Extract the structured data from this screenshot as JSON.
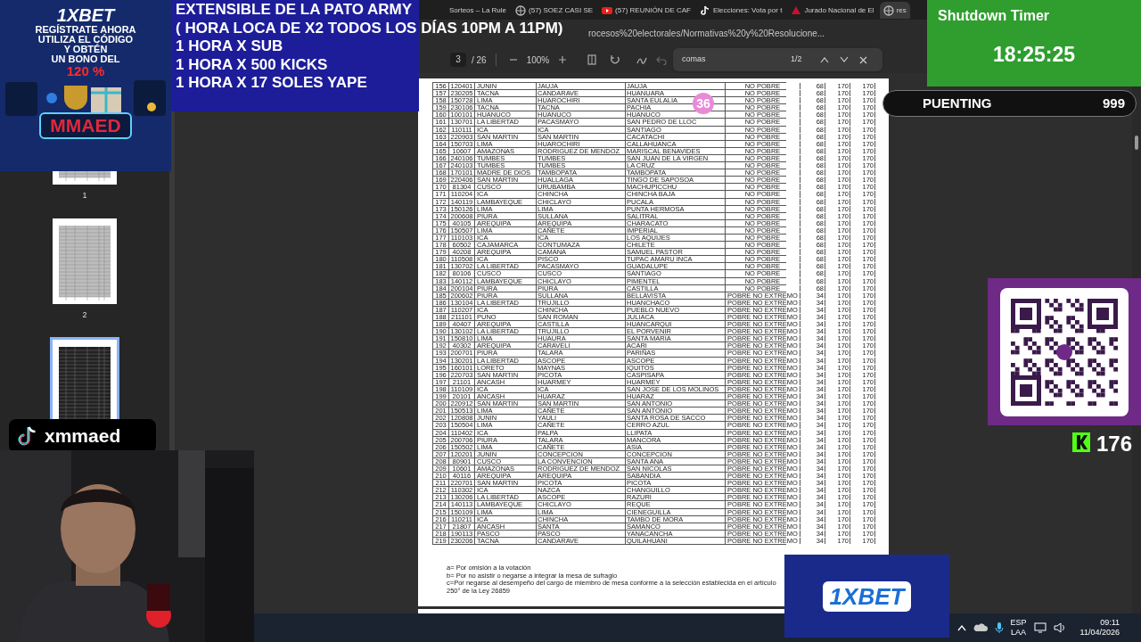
{
  "browser": {
    "tabs": [
      {
        "label": "Sorteos – La Rule",
        "selected": false
      },
      {
        "label": "(57) SOEZ CASI SE",
        "selected": false
      },
      {
        "label": "(57) REUNIÓN DE CAF",
        "selected": false
      },
      {
        "label": "Elecciones: Vota por t",
        "selected": false
      },
      {
        "label": "Jurado Nacional de El",
        "selected": false
      },
      {
        "label": "res",
        "selected": true
      }
    ],
    "address": "rocesos%20electorales/Normativas%20y%20Resolucione..."
  },
  "pdf_toolbar": {
    "page": "3",
    "page_count": "/ 26",
    "zoom": "100%"
  },
  "find_bar": {
    "query": "comas",
    "result": "1/2"
  },
  "sidebar": {
    "thumbnails": [
      {
        "label": "1",
        "selected": false
      },
      {
        "label": "2",
        "selected": false
      },
      {
        "selected": true
      }
    ]
  },
  "document": {
    "table": {
      "rows": [
        [
          "156",
          "120401",
          "JUNIN",
          "JAUJA",
          "JAUJA",
          "NO POBRE",
          "68",
          "170",
          "170"
        ],
        [
          "157",
          "230205",
          "TACNA",
          "CANDARAVE",
          "HUANUARA",
          "NO POBRE",
          "68",
          "170",
          "170"
        ],
        [
          "158",
          "150728",
          "LIMA",
          "HUAROCHIRI",
          "SANTA EULALIA",
          "NO POBRE",
          "68",
          "170",
          "170"
        ],
        [
          "159",
          "230106",
          "TACNA",
          "TACNA",
          "PACHIA",
          "NO POBRE",
          "68",
          "170",
          "170"
        ],
        [
          "160",
          "100101",
          "HUANUCO",
          "HUANUCO",
          "HUANUCO",
          "NO POBRE",
          "68",
          "170",
          "170"
        ],
        [
          "161",
          "130701",
          "LA LIBERTAD",
          "PACASMAYO",
          "SAN PEDRO DE LLOC",
          "NO POBRE",
          "68",
          "170",
          "170"
        ],
        [
          "162",
          "110111",
          "ICA",
          "ICA",
          "SANTIAGO",
          "NO POBRE",
          "68",
          "170",
          "170"
        ],
        [
          "163",
          "220903",
          "SAN MARTIN",
          "SAN MARTIN",
          "CACATACHI",
          "NO POBRE",
          "68",
          "170",
          "170"
        ],
        [
          "164",
          "150703",
          "LIMA",
          "HUAROCHIRI",
          "CALLAHUANCA",
          "NO POBRE",
          "68",
          "170",
          "170"
        ],
        [
          "165",
          "10607",
          "AMAZONAS",
          "RODRIGUEZ DE MENDOZ",
          "MARISCAL BENAVIDES",
          "NO POBRE",
          "68",
          "170",
          "170"
        ],
        [
          "166",
          "240106",
          "TUMBES",
          "TUMBES",
          "SAN JUAN DE LA VIRGEN",
          "NO POBRE",
          "68",
          "170",
          "170"
        ],
        [
          "167",
          "240103",
          "TUMBES",
          "TUMBES",
          "LA CRUZ",
          "NO POBRE",
          "68",
          "170",
          "170"
        ],
        [
          "168",
          "170101",
          "MADRE DE DIOS",
          "TAMBOPATA",
          "TAMBOPATA",
          "NO POBRE",
          "68",
          "170",
          "170"
        ],
        [
          "169",
          "220406",
          "SAN MARTIN",
          "HUALLAGA",
          "TINGO DE SAPOSOA",
          "NO POBRE",
          "68",
          "170",
          "170"
        ],
        [
          "170",
          "81304",
          "CUSCO",
          "URUBAMBA",
          "MACHUPICCHU",
          "NO POBRE",
          "68",
          "170",
          "170"
        ],
        [
          "171",
          "110204",
          "ICA",
          "CHINCHA",
          "CHINCHA BAJA",
          "NO POBRE",
          "68",
          "170",
          "170"
        ],
        [
          "172",
          "140119",
          "LAMBAYEQUE",
          "CHICLAYO",
          "PUCALA",
          "NO POBRE",
          "68",
          "170",
          "170"
        ],
        [
          "173",
          "150126",
          "LIMA",
          "LIMA",
          "PUNTA HERMOSA",
          "NO POBRE",
          "68",
          "170",
          "170"
        ],
        [
          "174",
          "200608",
          "PIURA",
          "SULLANA",
          "SALITRAL",
          "NO POBRE",
          "68",
          "170",
          "170"
        ],
        [
          "175",
          "40105",
          "AREQUIPA",
          "AREQUIPA",
          "CHARACATO",
          "NO POBRE",
          "68",
          "170",
          "170"
        ],
        [
          "176",
          "150507",
          "LIMA",
          "CAÑETE",
          "IMPERIAL",
          "NO POBRE",
          "68",
          "170",
          "170"
        ],
        [
          "177",
          "110103",
          "ICA",
          "ICA",
          "LOS AQUIJES",
          "NO POBRE",
          "68",
          "170",
          "170"
        ],
        [
          "178",
          "60502",
          "CAJAMARCA",
          "CONTUMAZA",
          "CHILETE",
          "NO POBRE",
          "68",
          "170",
          "170"
        ],
        [
          "179",
          "40208",
          "AREQUIPA",
          "CAMANA",
          "SAMUEL PASTOR",
          "NO POBRE",
          "68",
          "170",
          "170"
        ],
        [
          "180",
          "110508",
          "ICA",
          "PISCO",
          "TUPAC AMARU INCA",
          "NO POBRE",
          "68",
          "170",
          "170"
        ],
        [
          "181",
          "130702",
          "LA LIBERTAD",
          "PACASMAYO",
          "GUADALUPE",
          "NO POBRE",
          "68",
          "170",
          "170"
        ],
        [
          "182",
          "80106",
          "CUSCO",
          "CUSCO",
          "SANTIAGO",
          "NO POBRE",
          "68",
          "170",
          "170"
        ],
        [
          "183",
          "140112",
          "LAMBAYEQUE",
          "CHICLAYO",
          "PIMENTEL",
          "NO POBRE",
          "68",
          "170",
          "170"
        ],
        [
          "184",
          "200104",
          "PIURA",
          "PIURA",
          "CASTILLA",
          "NO POBRE",
          "68",
          "170",
          "170"
        ],
        [
          "185",
          "200602",
          "PIURA",
          "SULLANA",
          "BELLAVISTA",
          "POBRE NO EXTREMO",
          "34",
          "170",
          "170"
        ],
        [
          "186",
          "130104",
          "LA LIBERTAD",
          "TRUJILLO",
          "HUANCHACO",
          "POBRE NO EXTREMO",
          "34",
          "170",
          "170"
        ],
        [
          "187",
          "110207",
          "ICA",
          "CHINCHA",
          "PUEBLO NUEVO",
          "POBRE NO EXTREMO",
          "34",
          "170",
          "170"
        ],
        [
          "188",
          "211101",
          "PUNO",
          "SAN ROMAN",
          "JULIACA",
          "POBRE NO EXTREMO",
          "34",
          "170",
          "170"
        ],
        [
          "189",
          "40407",
          "AREQUIPA",
          "CASTILLA",
          "HUANCARQUI",
          "POBRE NO EXTREMO",
          "34",
          "170",
          "170"
        ],
        [
          "190",
          "130102",
          "LA LIBERTAD",
          "TRUJILLO",
          "EL PORVENIR",
          "POBRE NO EXTREMO",
          "34",
          "170",
          "170"
        ],
        [
          "191",
          "150810",
          "LIMA",
          "HUAURA",
          "SANTA MARIA",
          "POBRE NO EXTREMO",
          "34",
          "170",
          "170"
        ],
        [
          "192",
          "40302",
          "AREQUIPA",
          "CARAVELI",
          "ACARI",
          "POBRE NO EXTREMO",
          "34",
          "170",
          "170"
        ],
        [
          "193",
          "200701",
          "PIURA",
          "TALARA",
          "PARIÑAS",
          "POBRE NO EXTREMO",
          "34",
          "170",
          "170"
        ],
        [
          "194",
          "130201",
          "LA LIBERTAD",
          "ASCOPE",
          "ASCOPE",
          "POBRE NO EXTREMO",
          "34",
          "170",
          "170"
        ],
        [
          "195",
          "160101",
          "LORETO",
          "MAYNAS",
          "IQUITOS",
          "POBRE NO EXTREMO",
          "34",
          "170",
          "170"
        ],
        [
          "196",
          "220703",
          "SAN MARTIN",
          "PICOTA",
          "CASPISAPA",
          "POBRE NO EXTREMO",
          "34",
          "170",
          "170"
        ],
        [
          "197",
          "21101",
          "ANCASH",
          "HUARMEY",
          "HUARMEY",
          "POBRE NO EXTREMO",
          "34",
          "170",
          "170"
        ],
        [
          "198",
          "110109",
          "ICA",
          "ICA",
          "SAN JOSE DE LOS MOLINOS",
          "POBRE NO EXTREMO",
          "34",
          "170",
          "170"
        ],
        [
          "199",
          "20101",
          "ANCASH",
          "HUARAZ",
          "HUARAZ",
          "POBRE NO EXTREMO",
          "34",
          "170",
          "170"
        ],
        [
          "200",
          "220912",
          "SAN MARTIN",
          "SAN MARTIN",
          "SAN ANTONIO",
          "POBRE NO EXTREMO",
          "34",
          "170",
          "170"
        ],
        [
          "201",
          "150513",
          "LIMA",
          "CAÑETE",
          "SAN ANTONIO",
          "POBRE NO EXTREMO",
          "34",
          "170",
          "170"
        ],
        [
          "202",
          "120808",
          "JUNIN",
          "YAULI",
          "SANTA ROSA DE SACCO",
          "POBRE NO EXTREMO",
          "34",
          "170",
          "170"
        ],
        [
          "203",
          "150504",
          "LIMA",
          "CAÑETE",
          "CERRO AZUL",
          "POBRE NO EXTREMO",
          "34",
          "170",
          "170"
        ],
        [
          "204",
          "110402",
          "ICA",
          "PALPA",
          "LLIPATA",
          "POBRE NO EXTREMO",
          "34",
          "170",
          "170"
        ],
        [
          "205",
          "200706",
          "PIURA",
          "TALARA",
          "MANCORA",
          "POBRE NO EXTREMO",
          "34",
          "170",
          "170"
        ],
        [
          "206",
          "150502",
          "LIMA",
          "CAÑETE",
          "ASIA",
          "POBRE NO EXTREMO",
          "34",
          "170",
          "170"
        ],
        [
          "207",
          "120201",
          "JUNIN",
          "CONCEPCION",
          "CONCEPCION",
          "POBRE NO EXTREMO",
          "34",
          "170",
          "170"
        ],
        [
          "208",
          "80901",
          "CUSCO",
          "LA CONVENCION",
          "SANTA ANA",
          "POBRE NO EXTREMO",
          "34",
          "170",
          "170"
        ],
        [
          "209",
          "10601",
          "AMAZONAS",
          "RODRIGUEZ DE MENDOZ",
          "SAN NICOLAS",
          "POBRE NO EXTREMO",
          "34",
          "170",
          "170"
        ],
        [
          "210",
          "40116",
          "AREQUIPA",
          "AREQUIPA",
          "SABANDIA",
          "POBRE NO EXTREMO",
          "34",
          "170",
          "170"
        ],
        [
          "211",
          "220701",
          "SAN MARTIN",
          "PICOTA",
          "PICOTA",
          "POBRE NO EXTREMO",
          "34",
          "170",
          "170"
        ],
        [
          "212",
          "110302",
          "ICA",
          "NAZCA",
          "CHANGUILLO",
          "POBRE NO EXTREMO",
          "34",
          "170",
          "170"
        ],
        [
          "213",
          "130206",
          "LA LIBERTAD",
          "ASCOPE",
          "RAZURI",
          "POBRE NO EXTREMO",
          "34",
          "170",
          "170"
        ],
        [
          "214",
          "140113",
          "LAMBAYEQUE",
          "CHICLAYO",
          "REQUE",
          "POBRE NO EXTREMO",
          "34",
          "170",
          "170"
        ],
        [
          "215",
          "150109",
          "LIMA",
          "LIMA",
          "CIENEGUILLA",
          "POBRE NO EXTREMO",
          "34",
          "170",
          "170"
        ],
        [
          "216",
          "110211",
          "ICA",
          "CHINCHA",
          "TAMBO DE MORA",
          "POBRE NO EXTREMO",
          "34",
          "170",
          "170"
        ],
        [
          "217",
          "21807",
          "ANCASH",
          "SANTA",
          "SAMANCO",
          "POBRE NO EXTREMO",
          "34",
          "170",
          "170"
        ],
        [
          "218",
          "190113",
          "PASCO",
          "PASCO",
          "YANACANCHA",
          "POBRE NO EXTREMO",
          "34",
          "170",
          "170"
        ],
        [
          "219",
          "230206",
          "TACNA",
          "CANDARAVE",
          "QUILAHUANI",
          "POBRE NO EXTREMO",
          "34",
          "170",
          "170"
        ]
      ]
    },
    "footnotes": [
      "a= Por omisión a la votación",
      "b= Por no asistir o negarse a integrar la mesa de sufragio",
      "c=Por negarse al desempeño del cargo de miembro de mesa conforme a la selección establecida en el artículo 250° de la Ley 26859"
    ]
  },
  "taskbar": {
    "language": "ESP",
    "layout": "LAA",
    "time": "09:11",
    "date": "11/04/2026"
  },
  "stream_overlay": {
    "ad_top": {
      "brand": "1XBET",
      "lines": [
        "REGÍSTRATE AHORA",
        "UTILIZA EL CÓDIGO",
        "Y OBTÉN",
        "UN BONO DEL"
      ],
      "bonus": "120 %",
      "code": "MMAED"
    },
    "announcement": [
      "EXTENSIBLE  DE LA PATO ARMY",
      "( HORA LOCA DE X2 TODOS LOS DÍAS 10PM A 11PM)",
      "1 HORA X SUB",
      "1 HORA X 500 KICKS",
      "1 HORA X 17 SOLES YAPE"
    ],
    "shutdown_timer": {
      "title": "Shutdown Timer",
      "time": "18:25:25"
    },
    "goal_bar": {
      "label": "PUENTING",
      "value": "999",
      "badge": "36"
    },
    "kick_count": "176",
    "tiktok": {
      "handle": "xmmaed"
    },
    "ad_bottom": {
      "brand": "1XBET"
    },
    "webcam": {
      "kind": "picture"
    }
  }
}
